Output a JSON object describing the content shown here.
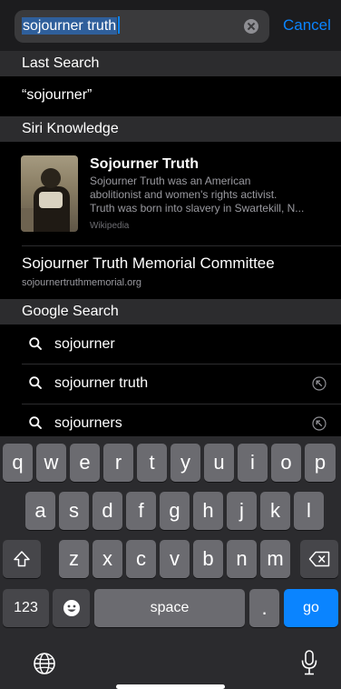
{
  "search": {
    "query": "sojourner truth",
    "cancel_label": "Cancel"
  },
  "last_search": {
    "header": "Last Search",
    "item": "“sojourner”"
  },
  "siri_knowledge": {
    "header": "Siri Knowledge",
    "title": "Sojourner Truth",
    "desc_line1": "Sojourner Truth was an American",
    "desc_line2": "abolitionist and women's rights activist.",
    "desc_line3": "Truth was born into slavery in Swartekill, N...",
    "source": "Wikipedia"
  },
  "memorial": {
    "title": "Sojourner Truth Memorial Committee",
    "url": "sojournertruthmemorial.org"
  },
  "google": {
    "header": "Google Search",
    "suggestions": [
      "sojourner",
      "sojourner truth",
      "sojourners"
    ]
  },
  "keyboard": {
    "row1": [
      "q",
      "w",
      "e",
      "r",
      "t",
      "y",
      "u",
      "i",
      "o",
      "p"
    ],
    "row2": [
      "a",
      "s",
      "d",
      "f",
      "g",
      "h",
      "j",
      "k",
      "l"
    ],
    "row3": [
      "z",
      "x",
      "c",
      "v",
      "b",
      "n",
      "m"
    ],
    "numbers_label": "123",
    "space_label": "space",
    "period_label": ".",
    "go_label": "go"
  },
  "colors": {
    "accent": "#0a84ff",
    "background": "#000000",
    "section_header": "#2c2c2e",
    "key": "#6b6b70",
    "key_dark": "#46464a"
  }
}
